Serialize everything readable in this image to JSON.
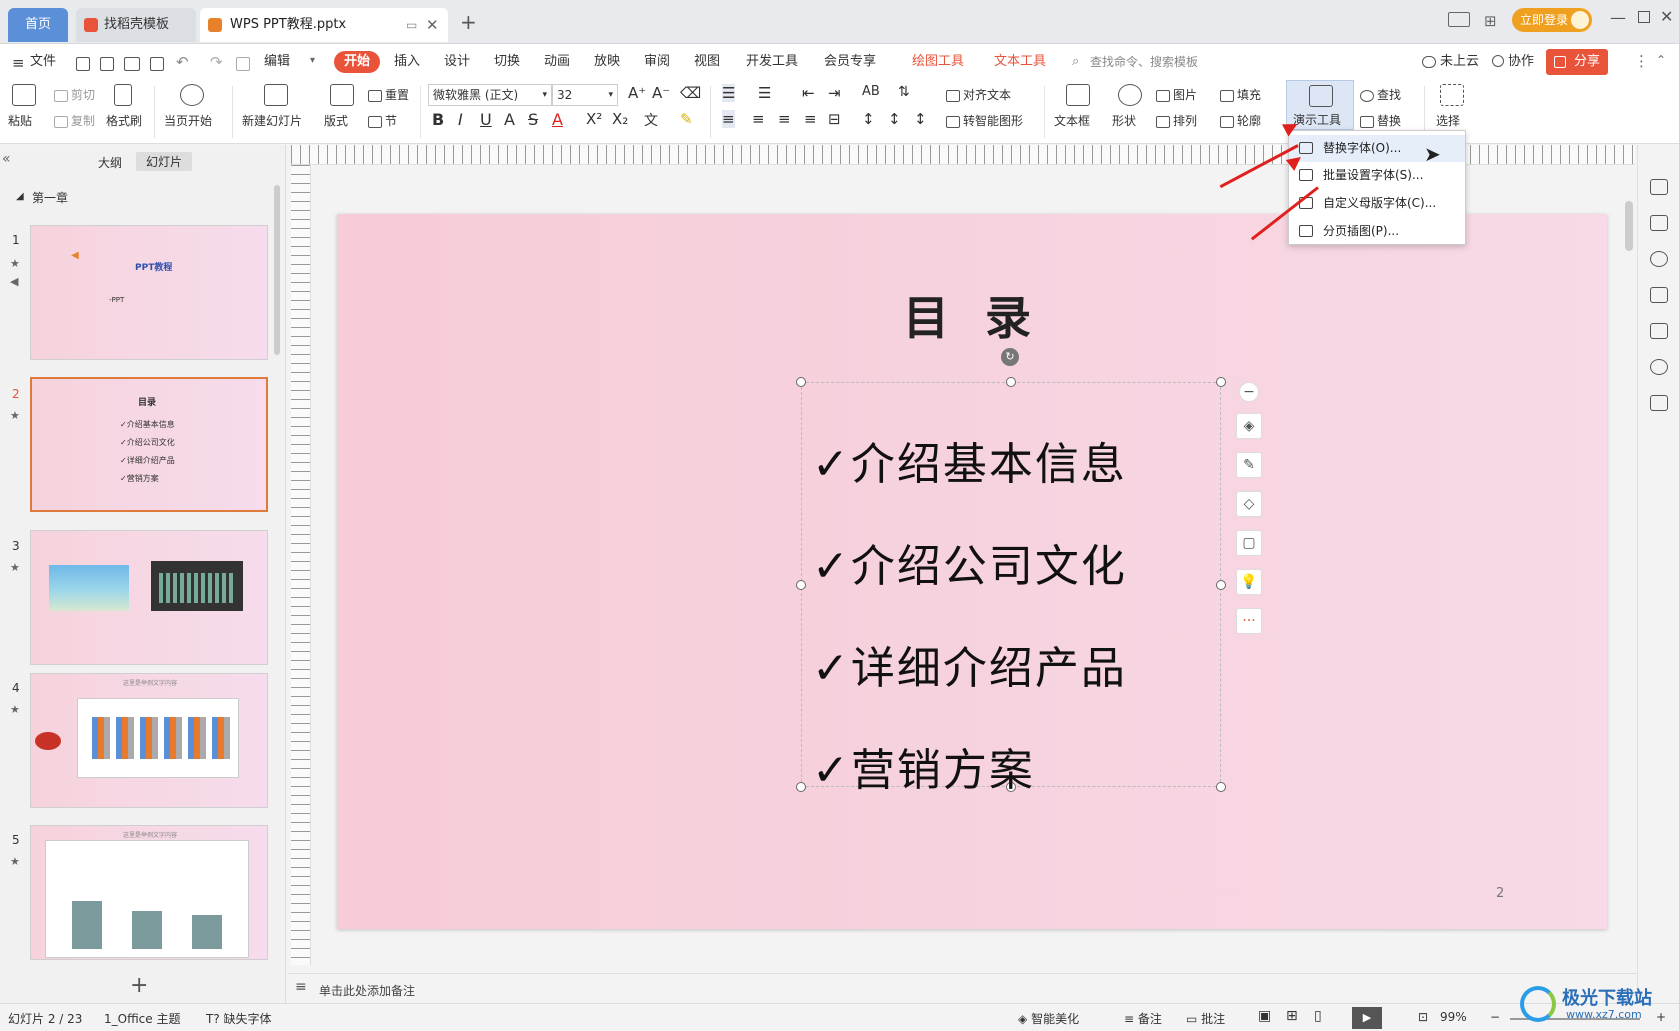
{
  "tabs": {
    "home": "首页",
    "template": "找稻壳模板",
    "document": "WPS PPT教程.pptx"
  },
  "titlebar": {
    "login": "立即登录"
  },
  "menu": {
    "file": "文件",
    "edit": "编辑",
    "start": "开始",
    "insert": "插入",
    "design": "设计",
    "switch": "切换",
    "animation": "动画",
    "show": "放映",
    "review": "审阅",
    "view": "视图",
    "dev": "开发工具",
    "member": "会员专享",
    "draw_tool": "绘图工具",
    "text_tool": "文本工具",
    "search_placeholder": "查找命令、搜索模板",
    "cloud": "未上云",
    "collab": "协作",
    "share": "分享"
  },
  "ribbon": {
    "paste": "粘贴",
    "cut": "剪切",
    "copy": "复制",
    "format_painter": "格式刷",
    "from_current": "当页开始",
    "new_slide": "新建幻灯片",
    "layout": "版式",
    "section": "节",
    "reset": "重置",
    "font_name": "微软雅黑 (正文)",
    "font_size": "32",
    "align_text": "对齐文本",
    "smart_shape": "转智能图形",
    "text_box": "文本框",
    "shape": "形状",
    "picture": "图片",
    "arrange": "排列",
    "fill": "填充",
    "outline": "轮廓",
    "present_tool": "演示工具",
    "find": "查找",
    "replace": "替换",
    "select": "选择"
  },
  "dropdown": {
    "items": [
      {
        "label": "替换字体(O)..."
      },
      {
        "label": "批量设置字体(S)..."
      },
      {
        "label": "自定义母版字体(C)..."
      },
      {
        "label": "分页插图(P)..."
      }
    ]
  },
  "left_panel": {
    "outline_tab": "大纲",
    "slides_tab": "幻灯片",
    "chapter": "第一章",
    "slides": [
      {
        "num": "1",
        "title": "PPT教程",
        "sub": "-PPT"
      },
      {
        "num": "2",
        "title": "目录",
        "items": [
          "✓介绍基本信息",
          "✓介绍公司文化",
          "✓详细介绍产品",
          "✓营销方案"
        ]
      },
      {
        "num": "3"
      },
      {
        "num": "4",
        "caption": "这里是举例文字内容"
      },
      {
        "num": "5",
        "caption": "这里是举例文字内容"
      }
    ]
  },
  "slide": {
    "title": "目 录",
    "bullets": [
      "✓介绍基本信息",
      "✓介绍公司文化",
      "✓详细介绍产品",
      "✓营销方案"
    ],
    "page_number": "2"
  },
  "notes": {
    "placeholder": "单击此处添加备注"
  },
  "status": {
    "slide_info": "幻灯片 2 / 23",
    "theme": "1_Office 主题",
    "missing_font": "缺失字体",
    "beautify": "智能美化",
    "notes": "备注",
    "comments": "批注",
    "zoom": "99%"
  },
  "watermark": {
    "text": "极光下载站",
    "url": "www.xz7.com"
  },
  "colors": {
    "accent": "#e8533a",
    "login": "#f0a020",
    "tab_home": "#5b8fd8",
    "arrow": "#e0201c"
  }
}
